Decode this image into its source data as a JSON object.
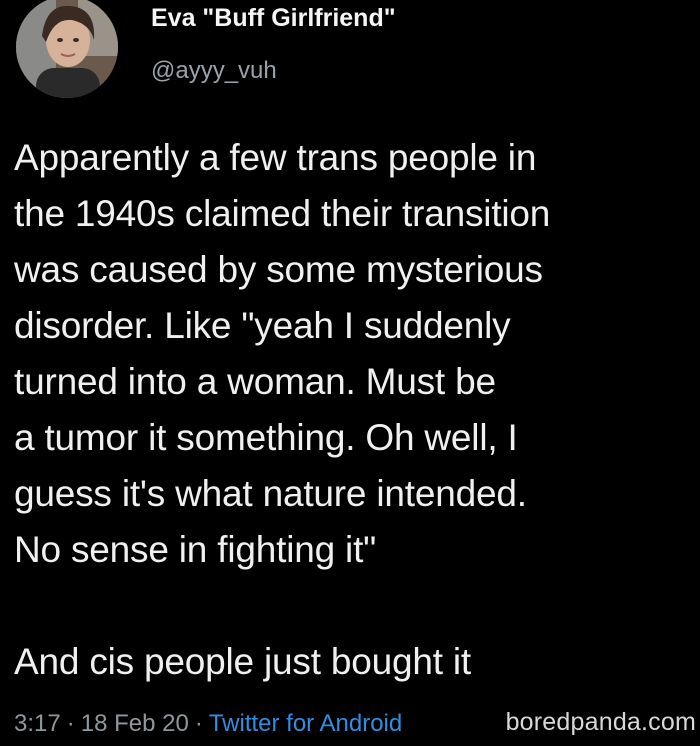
{
  "tweet": {
    "author": {
      "display_name": "Eva \"Buff Girlfriend\"",
      "handle": "@ayyy_vuh",
      "avatar_icon": "profile-photo"
    },
    "body_lines": [
      "Apparently a few trans people in",
      "the 1940s claimed their transition",
      "was caused by some mysterious",
      "disorder. Like \"yeah I suddenly",
      "turned into a woman. Must be",
      "a tumor it something. Oh well, I",
      "guess it's what nature intended.",
      "No sense in fighting it\""
    ],
    "body_followup": "And cis people just bought it",
    "meta": {
      "time": "3:17",
      "separator": "·",
      "date": "18 Feb 20",
      "source": "Twitter for Android"
    },
    "watermark": "boredpanda.com"
  },
  "colors": {
    "background": "#000000",
    "text": "#f0f0f0",
    "muted": "#8f979d",
    "link": "#2f8ee0"
  }
}
